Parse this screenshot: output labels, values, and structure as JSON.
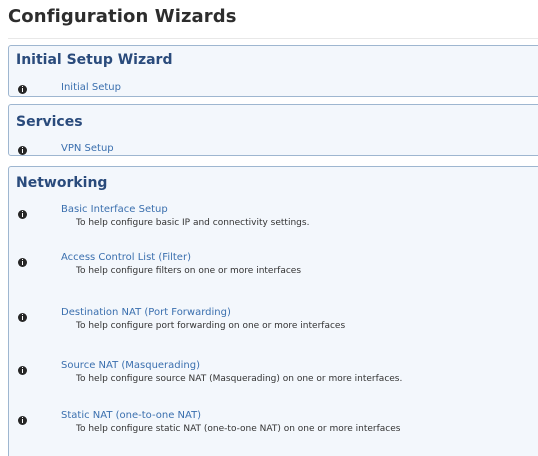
{
  "page": {
    "title": "Configuration Wizards"
  },
  "sections": [
    {
      "header": "Initial Setup Wizard",
      "items": [
        {
          "label": "Initial Setup",
          "description": "",
          "icon": "info-icon"
        }
      ]
    },
    {
      "header": "Services",
      "items": [
        {
          "label": "VPN Setup",
          "description": "",
          "icon": "info-icon"
        }
      ]
    },
    {
      "header": "Networking",
      "items": [
        {
          "label": "Basic Interface Setup",
          "description": "To help configure basic IP and connectivity settings.",
          "icon": "info-icon"
        },
        {
          "label": "Access Control List (Filter)",
          "description": "To help configure filters on one or more interfaces",
          "icon": "info-icon"
        },
        {
          "label": "Destination NAT (Port Forwarding)",
          "description": "To help configure port forwarding on one or more interfaces",
          "icon": "info-icon"
        },
        {
          "label": "Source NAT (Masquerading)",
          "description": "To help configure source NAT (Masquerading) on one or more interfaces.",
          "icon": "info-icon"
        },
        {
          "label": "Static NAT (one-to-one NAT)",
          "description": "To help configure static NAT (one-to-one NAT) on one or more interfaces",
          "icon": "info-icon"
        }
      ]
    }
  ],
  "colors": {
    "panel_background": "#f3f7fc",
    "panel_border": "#9eb6d0",
    "header_text": "#2a4b7c",
    "link_text": "#3a6fae",
    "icon": "#262626"
  }
}
